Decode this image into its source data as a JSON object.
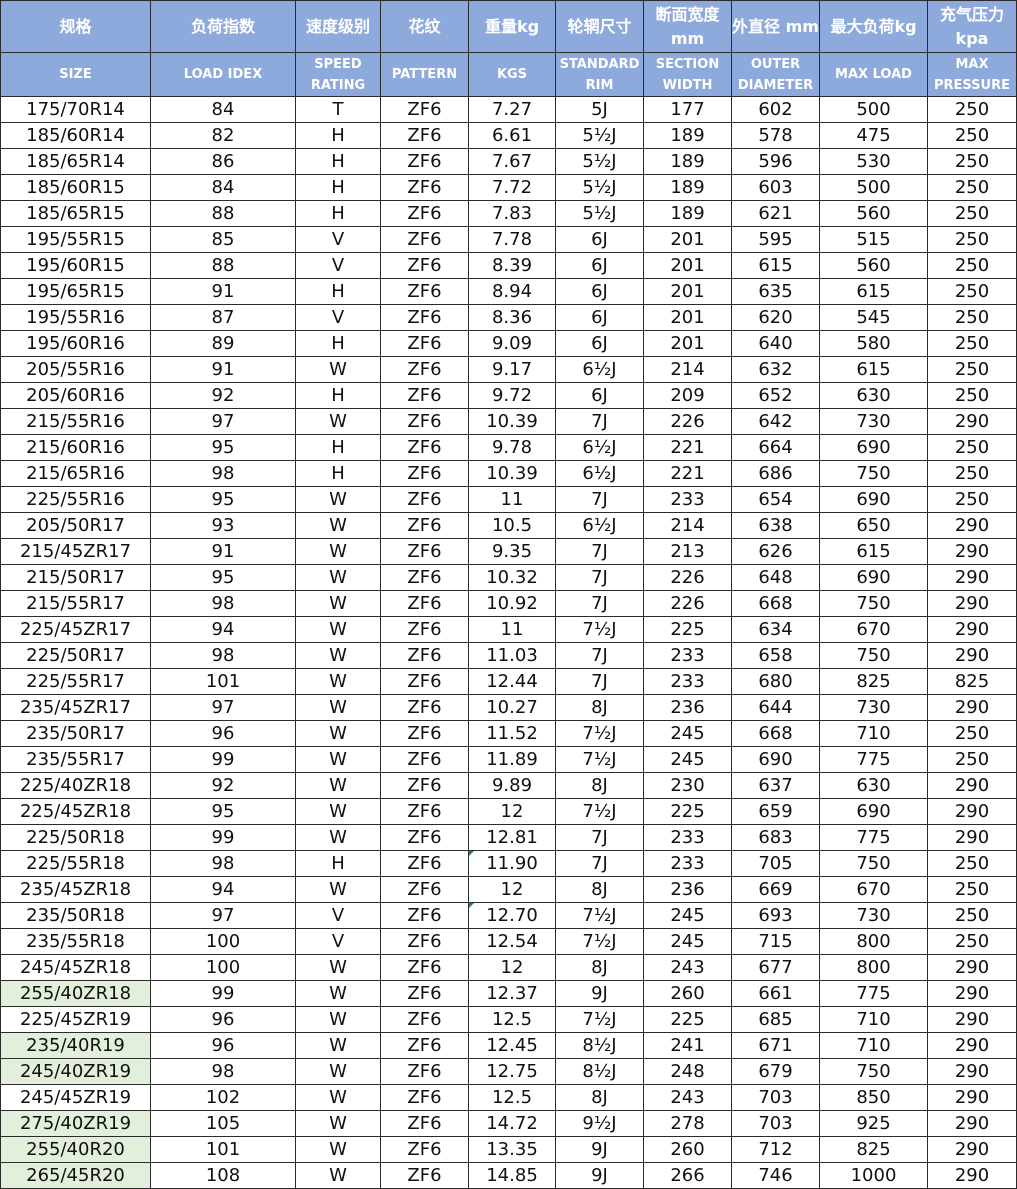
{
  "header": {
    "cn": [
      "规格",
      "负荷指数",
      "速度级别",
      "花纹",
      "重量kg",
      "轮辋尺寸",
      "断面宽度 mm",
      "外直径 mm",
      "最大负荷kg",
      "充气压力 kpa"
    ],
    "en": [
      "SIZE",
      "LOAD IDEX",
      "SPEED RATING",
      "PATTERN",
      "KGS",
      "STANDARD RIM",
      "SECTION WIDTH",
      "OUTER DIAMETER",
      "MAX LOAD",
      "MAX PRESSURE"
    ]
  },
  "colors": {
    "header_bg": "#8ea9db",
    "header_text": "#ffffff",
    "highlight": "#e2efda",
    "cell_marker": "#1e8c3a"
  },
  "rows": [
    {
      "cells": [
        "175/70R14",
        "84",
        "T",
        "ZF6",
        "7.27",
        "5J",
        "177",
        "602",
        "500",
        "250"
      ]
    },
    {
      "cells": [
        "185/60R14",
        "82",
        "H",
        "ZF6",
        "6.61",
        "5½J",
        "189",
        "578",
        "475",
        "250"
      ]
    },
    {
      "cells": [
        "185/65R14",
        "86",
        "H",
        "ZF6",
        "7.67",
        "5½J",
        "189",
        "596",
        "530",
        "250"
      ]
    },
    {
      "cells": [
        "185/60R15",
        "84",
        "H",
        "ZF6",
        "7.72",
        "5½J",
        "189",
        "603",
        "500",
        "250"
      ]
    },
    {
      "cells": [
        "185/65R15",
        "88",
        "H",
        "ZF6",
        "7.83",
        "5½J",
        "189",
        "621",
        "560",
        "250"
      ]
    },
    {
      "cells": [
        "195/55R15",
        "85",
        "V",
        "ZF6",
        "7.78",
        "6J",
        "201",
        "595",
        "515",
        "250"
      ]
    },
    {
      "cells": [
        "195/60R15",
        "88",
        "V",
        "ZF6",
        "8.39",
        "6J",
        "201",
        "615",
        "560",
        "250"
      ]
    },
    {
      "cells": [
        "195/65R15",
        "91",
        "H",
        "ZF6",
        "8.94",
        "6J",
        "201",
        "635",
        "615",
        "250"
      ]
    },
    {
      "cells": [
        "195/55R16",
        "87",
        "V",
        "ZF6",
        "8.36",
        "6J",
        "201",
        "620",
        "545",
        "250"
      ]
    },
    {
      "cells": [
        "195/60R16",
        "89",
        "H",
        "ZF6",
        "9.09",
        "6J",
        "201",
        "640",
        "580",
        "250"
      ]
    },
    {
      "cells": [
        "205/55R16",
        "91",
        "W",
        "ZF6",
        "9.17",
        "6½J",
        "214",
        "632",
        "615",
        "250"
      ]
    },
    {
      "cells": [
        "205/60R16",
        "92",
        "H",
        "ZF6",
        "9.72",
        "6J",
        "209",
        "652",
        "630",
        "250"
      ]
    },
    {
      "cells": [
        "215/55R16",
        "97",
        "W",
        "ZF6",
        "10.39",
        "7J",
        "226",
        "642",
        "730",
        "290"
      ]
    },
    {
      "cells": [
        "215/60R16",
        "95",
        "H",
        "ZF6",
        "9.78",
        "6½J",
        "221",
        "664",
        "690",
        "250"
      ]
    },
    {
      "cells": [
        "215/65R16",
        "98",
        "H",
        "ZF6",
        "10.39",
        "6½J",
        "221",
        "686",
        "750",
        "250"
      ]
    },
    {
      "cells": [
        "225/55R16",
        "95",
        "W",
        "ZF6",
        "11",
        "7J",
        "233",
        "654",
        "690",
        "250"
      ]
    },
    {
      "cells": [
        "205/50R17",
        "93",
        "W",
        "ZF6",
        "10.5",
        "6½J",
        "214",
        "638",
        "650",
        "290"
      ]
    },
    {
      "cells": [
        "215/45ZR17",
        "91",
        "W",
        "ZF6",
        "9.35",
        "7J",
        "213",
        "626",
        "615",
        "290"
      ]
    },
    {
      "cells": [
        "215/50R17",
        "95",
        "W",
        "ZF6",
        "10.32",
        "7J",
        "226",
        "648",
        "690",
        "290"
      ]
    },
    {
      "cells": [
        "215/55R17",
        "98",
        "W",
        "ZF6",
        "10.92",
        "7J",
        "226",
        "668",
        "750",
        "290"
      ]
    },
    {
      "cells": [
        "225/45ZR17",
        "94",
        "W",
        "ZF6",
        "11",
        "7½J",
        "225",
        "634",
        "670",
        "290"
      ]
    },
    {
      "cells": [
        "225/50R17",
        "98",
        "W",
        "ZF6",
        "11.03",
        "7J",
        "233",
        "658",
        "750",
        "290"
      ]
    },
    {
      "cells": [
        "225/55R17",
        "101",
        "W",
        "ZF6",
        "12.44",
        "7J",
        "233",
        "680",
        "825",
        "825"
      ]
    },
    {
      "cells": [
        "235/45ZR17",
        "97",
        "W",
        "ZF6",
        "10.27",
        "8J",
        "236",
        "644",
        "730",
        "290"
      ]
    },
    {
      "cells": [
        "235/50R17",
        "96",
        "W",
        "ZF6",
        "11.52",
        "7½J",
        "245",
        "668",
        "710",
        "250"
      ]
    },
    {
      "cells": [
        "235/55R17",
        "99",
        "W",
        "ZF6",
        "11.89",
        "7½J",
        "245",
        "690",
        "775",
        "250"
      ]
    },
    {
      "cells": [
        "225/40ZR18",
        "92",
        "W",
        "ZF6",
        "9.89",
        "8J",
        "230",
        "637",
        "630",
        "290"
      ]
    },
    {
      "cells": [
        "225/45ZR18",
        "95",
        "W",
        "ZF6",
        "12",
        "7½J",
        "225",
        "659",
        "690",
        "290"
      ]
    },
    {
      "cells": [
        "225/50R18",
        "99",
        "W",
        "ZF6",
        "12.81",
        "7J",
        "233",
        "683",
        "775",
        "290"
      ]
    },
    {
      "cells": [
        "225/55R18",
        "98",
        "H",
        "ZF6",
        "11.90",
        "7J",
        "233",
        "705",
        "750",
        "250"
      ],
      "mark": true
    },
    {
      "cells": [
        "235/45ZR18",
        "94",
        "W",
        "ZF6",
        "12",
        "8J",
        "236",
        "669",
        "670",
        "250"
      ]
    },
    {
      "cells": [
        "235/50R18",
        "97",
        "V",
        "ZF6",
        "12.70",
        "7½J",
        "245",
        "693",
        "730",
        "250"
      ],
      "mark": true
    },
    {
      "cells": [
        "235/55R18",
        "100",
        "V",
        "ZF6",
        "12.54",
        "7½J",
        "245",
        "715",
        "800",
        "250"
      ]
    },
    {
      "cells": [
        "245/45ZR18",
        "100",
        "W",
        "ZF6",
        "12",
        "8J",
        "243",
        "677",
        "800",
        "290"
      ]
    },
    {
      "cells": [
        "255/40ZR18",
        "99",
        "W",
        "ZF6",
        "12.37",
        "9J",
        "260",
        "661",
        "775",
        "290"
      ],
      "hl": true
    },
    {
      "cells": [
        "225/45ZR19",
        "96",
        "W",
        "ZF6",
        "12.5",
        "7½J",
        "225",
        "685",
        "710",
        "290"
      ]
    },
    {
      "cells": [
        "235/40R19",
        "96",
        "W",
        "ZF6",
        "12.45",
        "8½J",
        "241",
        "671",
        "710",
        "290"
      ],
      "hl": true
    },
    {
      "cells": [
        "245/40ZR19",
        "98",
        "W",
        "ZF6",
        "12.75",
        "8½J",
        "248",
        "679",
        "750",
        "290"
      ],
      "hl": true
    },
    {
      "cells": [
        "245/45ZR19",
        "102",
        "W",
        "ZF6",
        "12.5",
        "8J",
        "243",
        "703",
        "850",
        "290"
      ]
    },
    {
      "cells": [
        "275/40ZR19",
        "105",
        "W",
        "ZF6",
        "14.72",
        "9½J",
        "278",
        "703",
        "925",
        "290"
      ],
      "hl": true
    },
    {
      "cells": [
        "255/40R20",
        "101",
        "W",
        "ZF6",
        "13.35",
        "9J",
        "260",
        "712",
        "825",
        "290"
      ],
      "hl": true
    },
    {
      "cells": [
        "265/45R20",
        "108",
        "W",
        "ZF6",
        "14.85",
        "9J",
        "266",
        "746",
        "1000",
        "290"
      ],
      "hl": true
    }
  ]
}
